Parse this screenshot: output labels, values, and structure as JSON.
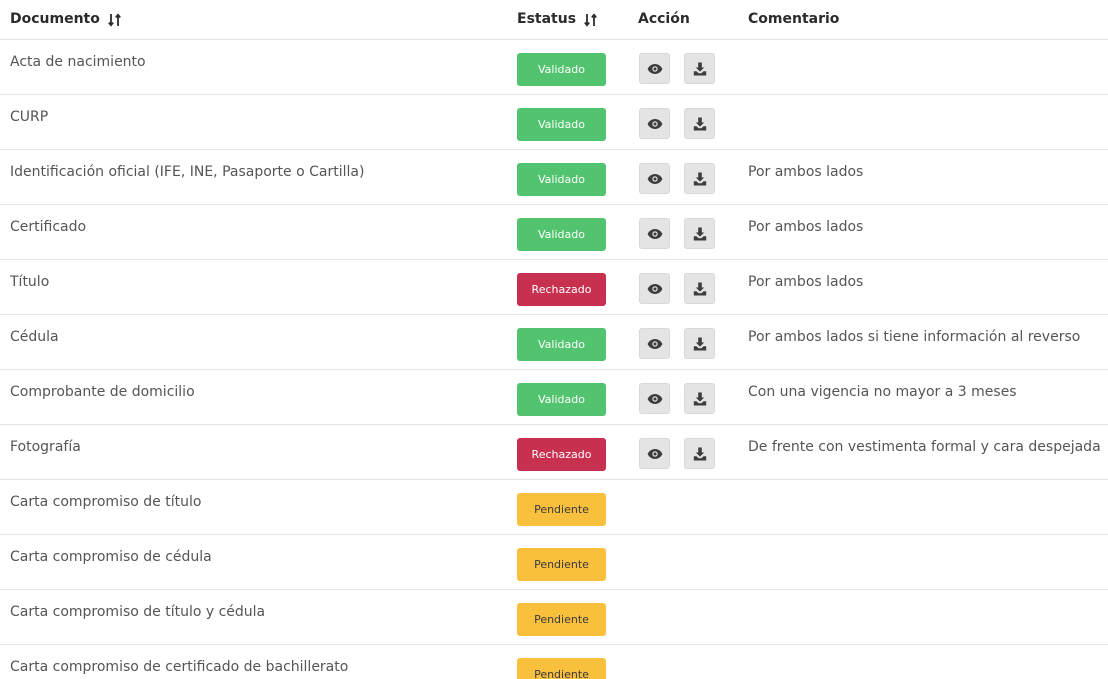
{
  "header": {
    "documento": "Documento",
    "estatus": "Estatus",
    "accion": "Acción",
    "comentario": "Comentario",
    "sort_icon": "sort-arrows-icon"
  },
  "colors": {
    "validado": "#52c46f",
    "rechazado": "#c7304f",
    "pendiente": "#f9c03e",
    "button_bg": "#e4e4e4",
    "icon": "#3d3d3d"
  },
  "rows": [
    {
      "documento": "Acta de nacimiento",
      "estatus": "Validado",
      "comentario": ""
    },
    {
      "documento": "CURP",
      "estatus": "Validado",
      "comentario": ""
    },
    {
      "documento": "Identificación oficial (IFE, INE, Pasaporte o Cartilla)",
      "estatus": "Validado",
      "comentario": "Por ambos lados"
    },
    {
      "documento": "Certificado",
      "estatus": "Validado",
      "comentario": "Por ambos lados"
    },
    {
      "documento": "Título",
      "estatus": "Rechazado",
      "comentario": "Por ambos lados"
    },
    {
      "documento": "Cédula",
      "estatus": "Validado",
      "comentario": "Por ambos lados si tiene información al reverso"
    },
    {
      "documento": "Comprobante de domicilio",
      "estatus": "Validado",
      "comentario": "Con una vigencia no mayor a 3 meses"
    },
    {
      "documento": "Fotografía",
      "estatus": "Rechazado",
      "comentario": "De frente con vestimenta formal y cara despejada"
    },
    {
      "documento": "Carta compromiso de título",
      "estatus": "Pendiente",
      "comentario": ""
    },
    {
      "documento": "Carta compromiso de cédula",
      "estatus": "Pendiente",
      "comentario": ""
    },
    {
      "documento": "Carta compromiso de título y cédula",
      "estatus": "Pendiente",
      "comentario": ""
    },
    {
      "documento": "Carta compromiso de certificado de bachillerato",
      "estatus": "Pendiente",
      "comentario": ""
    }
  ],
  "actions": {
    "view_icon": "eye-icon",
    "download_icon": "download-icon"
  }
}
